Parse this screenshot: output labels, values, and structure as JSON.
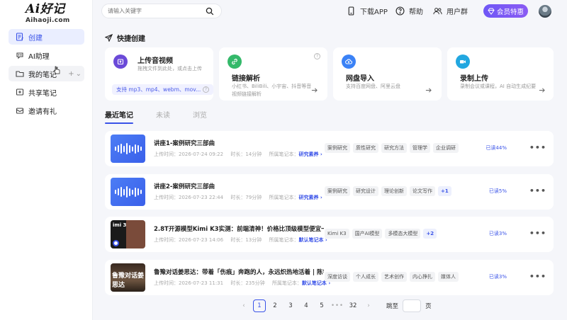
{
  "logo": {
    "main": "好记",
    "ai": "Ai",
    "sub": "Aihaoji.com"
  },
  "sidebar": {
    "items": [
      {
        "label": "创建",
        "icon": "create-icon",
        "active": true
      },
      {
        "label": "AI助理",
        "icon": "ai-assistant-icon"
      },
      {
        "label": "我的笔记",
        "icon": "folder-icon"
      },
      {
        "label": "共享笔记",
        "icon": "share-icon"
      },
      {
        "label": "邀请有礼",
        "icon": "gift-icon"
      }
    ],
    "notes_plus": "+",
    "notes_chevron": "⌄"
  },
  "header": {
    "search_placeholder": "请输入关键字",
    "download": "下载APP",
    "help": "帮助",
    "group": "用户群",
    "vip": "会员特惠"
  },
  "quick_create": {
    "title": "快捷创建",
    "cards": [
      {
        "title": "上传音视频",
        "desc": "拖拽文件到此处，或点击上传",
        "formats": "支持 mp3、mp4、webm、mov...",
        "icon": "upload-icon",
        "color": "#6b4ad8"
      },
      {
        "title": "链接解析",
        "desc": "小红书、BiliBili、小宇宙、抖音等音视频链接解析",
        "icon": "link-icon",
        "color": "#34b96a"
      },
      {
        "title": "网盘导入",
        "desc": "支持百度网盘、阿里云盘",
        "icon": "cloud-icon",
        "color": "#3b82f6"
      },
      {
        "title": "录制上传",
        "desc": "录制会议或课程，AI 自动生成纪要",
        "icon": "video-record-icon",
        "color": "#22a7e0"
      }
    ],
    "help_mark": "?"
  },
  "tabs": [
    {
      "label": "最近笔记",
      "active": true
    },
    {
      "label": "未读"
    },
    {
      "label": "浏览"
    }
  ],
  "notes": [
    {
      "title": "讲座1-案例研究三部曲",
      "upload_label": "上传时间：",
      "upload_time": "2026-07-24 09:22",
      "duration_label": "时长：",
      "duration": "14分钟",
      "notebook_label": "所属笔记本：",
      "notebook": "研究素养 ›",
      "tags": [
        "案例研究",
        "质性研究",
        "研究方法",
        "管理学",
        "企业调研"
      ],
      "extra": "",
      "progress": "已读44%",
      "thumb": "audio"
    },
    {
      "title": "讲座2-案例研究三部曲",
      "upload_label": "上传时间：",
      "upload_time": "2026-07-23 22:44",
      "duration_label": "时长：",
      "duration": "79分钟",
      "notebook_label": "所属笔记本：",
      "notebook": "研究素养 ›",
      "tags": [
        "案例研究",
        "研究设计",
        "理论创新",
        "论文写作"
      ],
      "extra": "+1",
      "progress": "已读5%",
      "thumb": "audio"
    },
    {
      "title": "2.8T开源模型Kimi K3实测：前端清神！价格比顶级模型便宜一半！",
      "upload_label": "上传时间：",
      "upload_time": "2026-07-23 14:06",
      "duration_label": "时长：",
      "duration": "13分钟",
      "notebook_label": "所属笔记本：",
      "notebook": "默认笔记本 ›",
      "tags": [
        "Kimi K3",
        "国产AI模型",
        "多模态大模型"
      ],
      "extra": "+2",
      "progress": "已读3%",
      "thumb": "video1",
      "thumb_text": "imi 3"
    },
    {
      "title": "鲁豫对话姜思达：带着「伤痕」奔跑的人，永远炽热地活着 | 陈鲁...",
      "upload_label": "上传时间：",
      "upload_time": "2026-07-23 11:31",
      "duration_label": "时长：",
      "duration": "235分钟",
      "notebook_label": "所属笔记本：",
      "notebook": "默认笔记本 ›",
      "tags": [
        "深度访谈",
        "个人成长",
        "艺术创作",
        "内心挣扎",
        "媒体人"
      ],
      "extra": "",
      "progress": "已读3%",
      "thumb": "video2",
      "thumb_text": "鲁豫对话姜思达"
    }
  ],
  "more_label": "•••",
  "pagination": {
    "prev": "‹",
    "next": "›",
    "pages": [
      "1",
      "2",
      "3",
      "4",
      "5"
    ],
    "dots": "•••",
    "last": "32",
    "jump_label": "跳至",
    "page_unit": "页"
  }
}
